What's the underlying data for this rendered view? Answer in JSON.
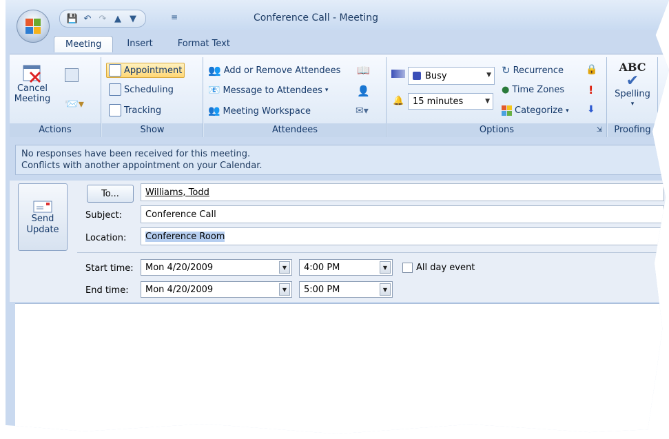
{
  "window": {
    "title": "Conference Call - Meeting"
  },
  "quick_access": [
    "save-icon",
    "undo-icon",
    "redo-icon",
    "up-arrow-icon",
    "down-arrow-icon",
    "customize-icon"
  ],
  "tabs": [
    {
      "label": "Meeting",
      "active": true
    },
    {
      "label": "Insert"
    },
    {
      "label": "Format Text"
    }
  ],
  "ribbon": {
    "actions": {
      "caption": "Actions",
      "cancel_label_1": "Cancel",
      "cancel_label_2": "Meeting"
    },
    "show": {
      "caption": "Show",
      "items": [
        "Appointment",
        "Scheduling",
        "Tracking"
      ]
    },
    "attendees": {
      "caption": "Attendees",
      "items": [
        "Add or Remove Attendees",
        "Message to Attendees",
        "Meeting Workspace"
      ]
    },
    "options": {
      "caption": "Options",
      "show_as": "Busy",
      "reminder": "15 minutes",
      "recurrence": "Recurrence",
      "time_zones": "Time Zones",
      "categorize": "Categorize"
    },
    "proofing": {
      "caption": "Proofing",
      "spelling": "Spelling",
      "abc": "ABC"
    }
  },
  "info": {
    "line1": "No responses have been received for this meeting.",
    "line2": "Conflicts with another appointment on your Calendar."
  },
  "form": {
    "send_label_1": "Send",
    "send_label_2": "Update",
    "to_button": "To...",
    "to_value": "Williams, Todd",
    "subject_label": "Subject:",
    "subject_value": "Conference Call",
    "location_label": "Location:",
    "location_value": "Conference Room",
    "start_label": "Start time:",
    "start_date": "Mon 4/20/2009",
    "start_time": "4:00 PM",
    "end_label": "End time:",
    "end_date": "Mon 4/20/2009",
    "end_time": "5:00 PM",
    "all_day": "All day event"
  },
  "colors": {
    "accent": "#15396a",
    "ribbon_bg": "#dbe7f5",
    "busy": "#3b4fb8"
  }
}
